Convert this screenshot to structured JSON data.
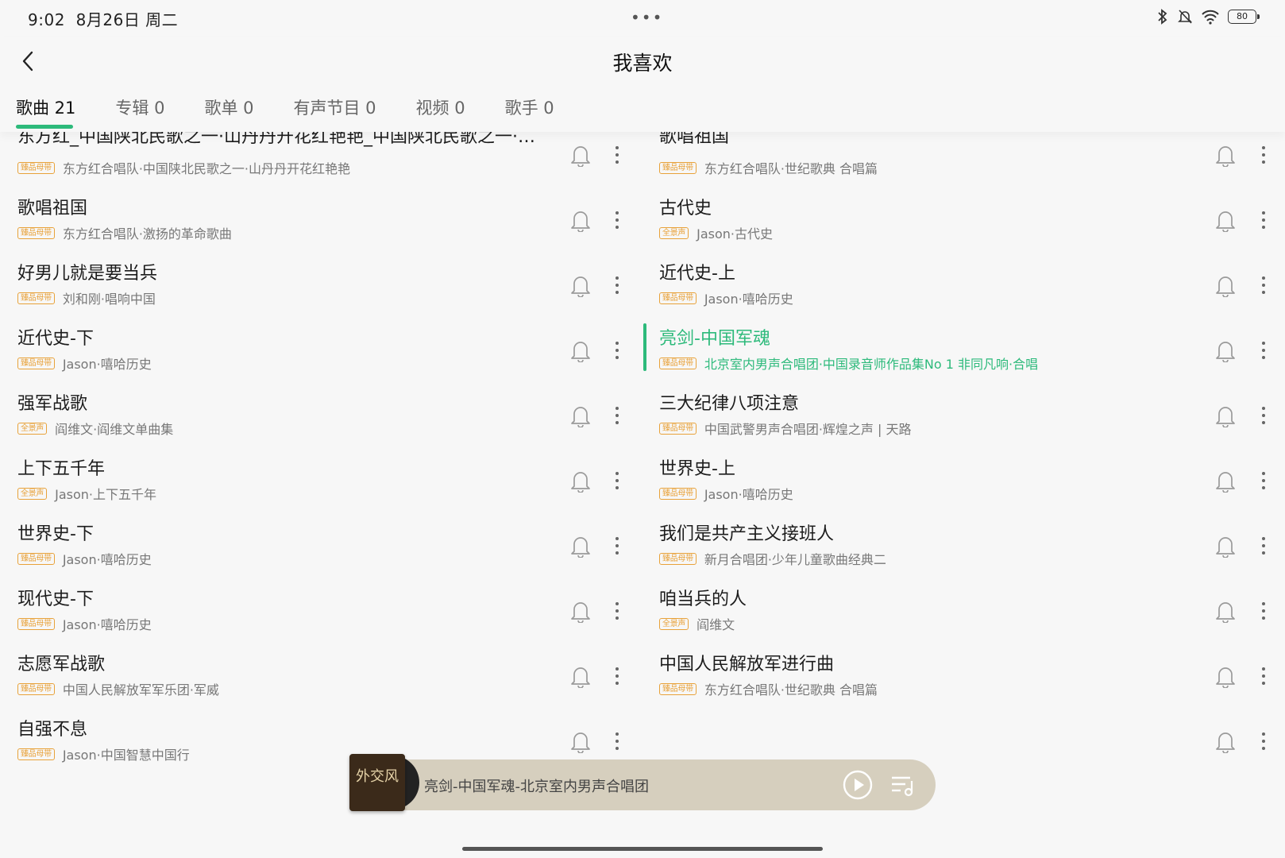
{
  "status": {
    "time": "9:02",
    "date": "8月26日 周二",
    "battery": "80"
  },
  "header": {
    "title": "我喜欢"
  },
  "tabs": [
    {
      "label": "歌曲 21"
    },
    {
      "label": "专辑 0"
    },
    {
      "label": "歌单 0"
    },
    {
      "label": "有声节目 0"
    },
    {
      "label": "视频 0"
    },
    {
      "label": "歌手 0"
    }
  ],
  "left_songs": [
    {
      "title": "东方红_中国陕北民歌之一·山丹丹开花红艳艳_中国陕北民歌之一·…",
      "badge": "臻品母带",
      "meta": "东方红合唱队·中国陕北民歌之一·山丹丹开花红艳艳"
    },
    {
      "title": "歌唱祖国",
      "badge": "臻品母带",
      "meta": "东方红合唱队·激扬的革命歌曲"
    },
    {
      "title": "好男儿就是要当兵",
      "badge": "臻品母带",
      "meta": "刘和刚·唱响中国"
    },
    {
      "title": "近代史-下",
      "badge": "臻品母带",
      "meta": "Jason·嘻哈历史"
    },
    {
      "title": "强军战歌",
      "badge": "全景声",
      "meta": "阎维文·阎维文单曲集"
    },
    {
      "title": "上下五千年",
      "badge": "全景声",
      "meta": "Jason·上下五千年"
    },
    {
      "title": "世界史-下",
      "badge": "臻品母带",
      "meta": "Jason·嘻哈历史"
    },
    {
      "title": "现代史-下",
      "badge": "臻品母带",
      "meta": "Jason·嘻哈历史"
    },
    {
      "title": "志愿军战歌",
      "badge": "臻品母带",
      "meta": "中国人民解放军军乐团·军威"
    },
    {
      "title": "自强不息",
      "badge": "臻品母带",
      "meta": "Jason·中国智慧中国行"
    }
  ],
  "right_songs": [
    {
      "title": "歌唱祖国",
      "badge": "臻品母带",
      "meta": "东方红合唱队·世纪歌典 合唱篇"
    },
    {
      "title": "古代史",
      "badge": "全景声",
      "meta": "Jason·古代史"
    },
    {
      "title": "近代史-上",
      "badge": "臻品母带",
      "meta": "Jason·嘻哈历史"
    },
    {
      "title": "亮剑-中国军魂",
      "badge": "臻品母带",
      "meta": "北京室内男声合唱团·中国录音师作品集No 1 非同凡响·合唱"
    },
    {
      "title": "三大纪律八项注意",
      "badge": "臻品母带",
      "meta": "中国武警男声合唱团·辉煌之声 | 天路"
    },
    {
      "title": "世界史-上",
      "badge": "臻品母带",
      "meta": "Jason·嘻哈历史"
    },
    {
      "title": "我们是共产主义接班人",
      "badge": "臻品母带",
      "meta": "新月合唱团·少年儿童歌曲经典二"
    },
    {
      "title": "咱当兵的人",
      "badge": "全景声",
      "meta": "阎维文"
    },
    {
      "title": "中国人民解放军进行曲",
      "badge": "臻品母带",
      "meta": "东方红合唱队·世纪歌典 合唱篇"
    }
  ],
  "player": {
    "now_playing": "亮剑-中国军魂-北京室内男声合唱团",
    "cover_text": "外交风"
  },
  "colors": {
    "accent": "#2dba7b",
    "badge": "#e8a23a",
    "player_bg": "#d6cfbe"
  }
}
